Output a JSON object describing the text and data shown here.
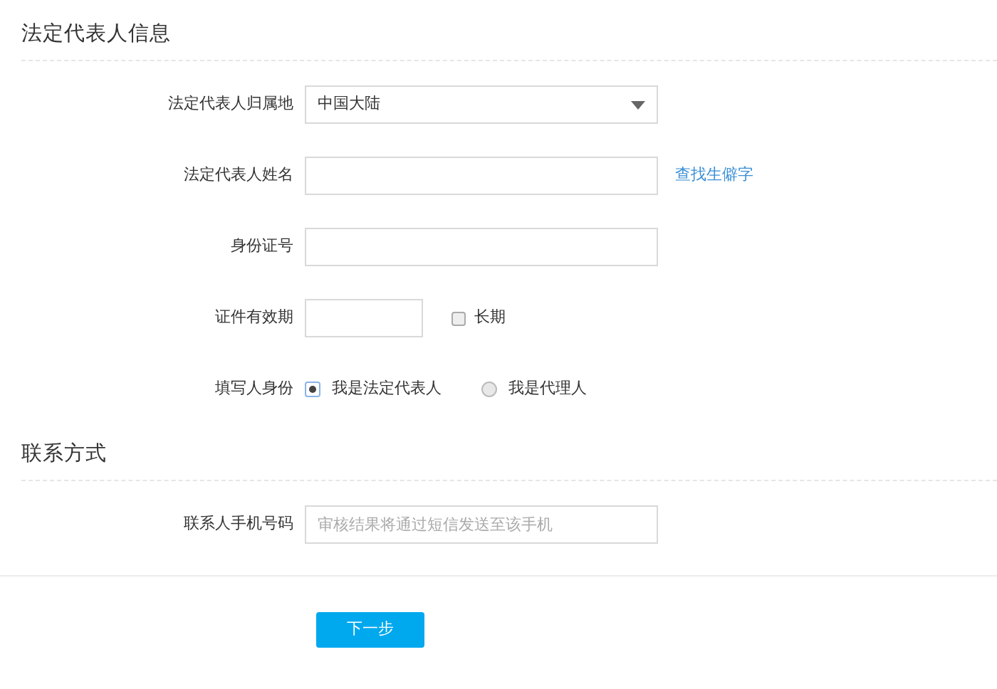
{
  "sections": [
    {
      "title": "法定代表人信息",
      "fields": [
        {
          "kind": "select",
          "label": "法定代表人归属地",
          "value": "中国大陆"
        },
        {
          "kind": "text",
          "label": "法定代表人姓名",
          "link": "查找生僻字"
        },
        {
          "kind": "text",
          "label": "身份证号"
        },
        {
          "kind": "date",
          "label": "证件有效期",
          "checkbox": {
            "label": "长期",
            "checked": false
          }
        },
        {
          "kind": "radio",
          "label": "填写人身份",
          "options": [
            {
              "label": "我是法定代表人",
              "selected": true
            },
            {
              "label": "我是代理人",
              "selected": false
            }
          ]
        }
      ]
    },
    {
      "title": "联系方式",
      "fields": [
        {
          "kind": "text",
          "label": "联系人手机号码",
          "placeholder": "审核结果将通过短信发送至该手机"
        }
      ]
    }
  ],
  "next_button": "下一步"
}
